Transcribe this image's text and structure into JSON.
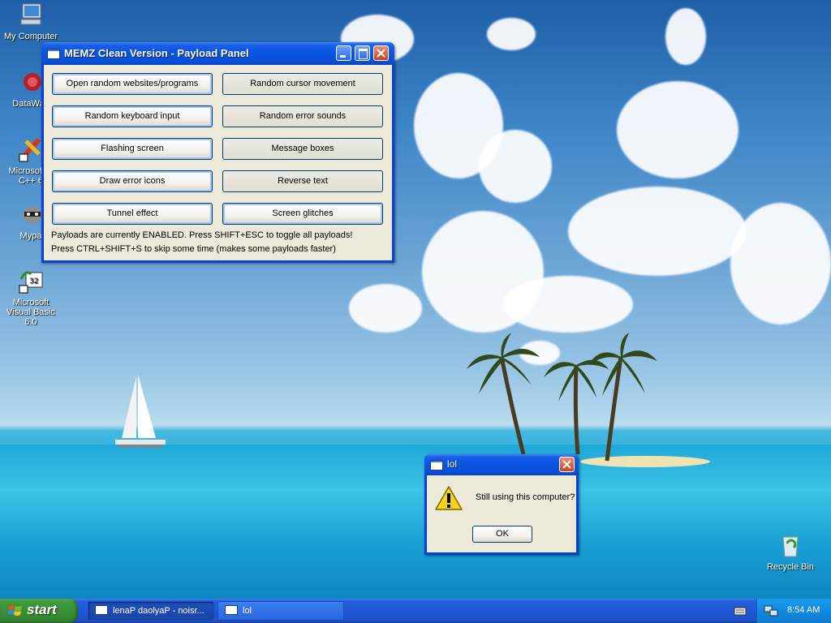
{
  "desktop": {
    "icons": [
      {
        "label": "My Computer"
      },
      {
        "label": "DataWag"
      },
      {
        "label": "Microsoft V C++ 6"
      },
      {
        "label": "Mypa"
      },
      {
        "label": "Microsoft Visual Basic 6.0"
      },
      {
        "label": "Recycle Bin"
      }
    ]
  },
  "payload_window": {
    "title": "MEMZ Clean Version - Payload Panel",
    "buttons": [
      {
        "label": "Open random websites/programs",
        "enabled": true
      },
      {
        "label": "Random cursor movement",
        "enabled": false
      },
      {
        "label": "Random keyboard input",
        "enabled": true
      },
      {
        "label": "Random error sounds",
        "enabled": false
      },
      {
        "label": "Flashing screen",
        "enabled": true
      },
      {
        "label": "Message boxes",
        "enabled": false
      },
      {
        "label": "Draw error icons",
        "enabled": true
      },
      {
        "label": "Reverse text",
        "enabled": false
      },
      {
        "label": "Tunnel effect",
        "enabled": true
      },
      {
        "label": "Screen glitches",
        "enabled": true
      }
    ],
    "status_line_1": "Payloads are currently ENABLED. Press SHIFT+ESC to toggle all payloads!",
    "status_line_2": "Press CTRL+SHIFT+S to skip some time (makes some payloads faster)"
  },
  "msg_dialog": {
    "title": "lol",
    "message": "Still using this computer?",
    "ok_label": "OK",
    "icon": "warning-icon"
  },
  "taskbar": {
    "start_label": "start",
    "tasks": [
      {
        "label": "lenaP daolyaP - noisr..."
      },
      {
        "label": "lol"
      }
    ],
    "clock": "8:54 AM"
  },
  "colors": {
    "title_blue": "#0a4fd6",
    "dialog_face": "#ece9d8",
    "start_green": "#388f37",
    "warning_yellow": "#f7d51d"
  }
}
